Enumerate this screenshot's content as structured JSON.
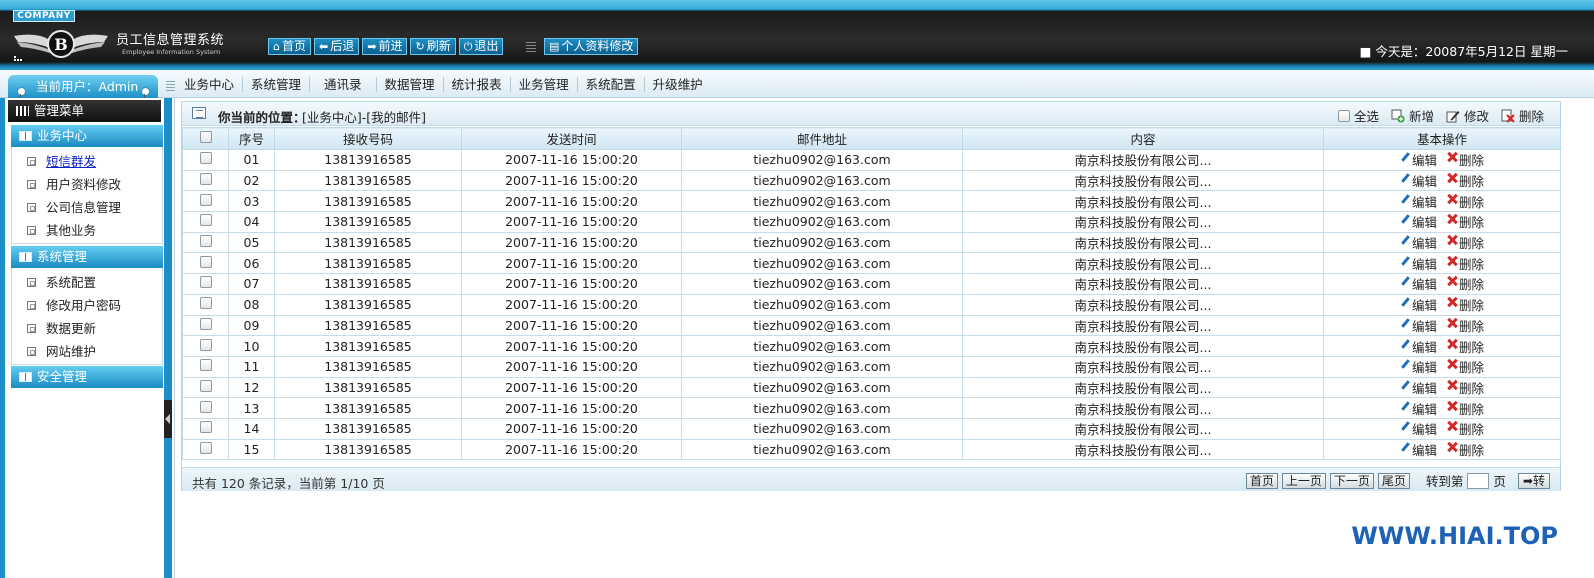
{
  "header": {
    "company_badge": "COMPANY",
    "title": "员工信息管理系统",
    "subtitle": "Employee Information System",
    "nav": [
      {
        "label": "首页",
        "icon": "home-icon"
      },
      {
        "label": "后退",
        "icon": "arrow-left-icon"
      },
      {
        "label": "前进",
        "icon": "arrow-right-icon"
      },
      {
        "label": "刷新",
        "icon": "refresh-icon"
      },
      {
        "label": "退出",
        "icon": "power-icon"
      }
    ],
    "profile_button": "个人资料修改",
    "date_text": "今天是：20087年5月12日 星期一"
  },
  "menubar": {
    "current_user": "当前用户：Admin",
    "items": [
      "业务中心",
      "系统管理",
      "通讯录",
      "数据管理",
      "统计报表",
      "业务管理",
      "系统配置",
      "升级维护"
    ]
  },
  "sidebar": {
    "title": "管理菜单",
    "sections": [
      {
        "title": "业务中心",
        "items": [
          "短信群发",
          "用户资料修改",
          "公司信息管理",
          "其他业务"
        ]
      },
      {
        "title": "系统管理",
        "items": [
          "系统配置",
          "修改用户密码",
          "数据更新",
          "网站维护"
        ]
      },
      {
        "title": "安全管理",
        "items": []
      }
    ]
  },
  "location": {
    "label": "你当前的位置：",
    "value": "[业务中心]-[我的邮件]"
  },
  "actions": {
    "select_all": "全选",
    "add": "新增",
    "edit": "修改",
    "delete": "删除"
  },
  "table": {
    "columns": [
      "序号",
      "接收号码",
      "发送时间",
      "邮件地址",
      "内容",
      "基本操作"
    ],
    "edit_label": "编辑",
    "delete_label": "删除",
    "rows": [
      [
        "01",
        "13813916585",
        "2007-11-16 15:00:20",
        "tiezhu0902@163.com",
        "南京科技股份有限公司..."
      ],
      [
        "02",
        "13813916585",
        "2007-11-16 15:00:20",
        "tiezhu0902@163.com",
        "南京科技股份有限公司..."
      ],
      [
        "03",
        "13813916585",
        "2007-11-16 15:00:20",
        "tiezhu0902@163.com",
        "南京科技股份有限公司..."
      ],
      [
        "04",
        "13813916585",
        "2007-11-16 15:00:20",
        "tiezhu0902@163.com",
        "南京科技股份有限公司..."
      ],
      [
        "05",
        "13813916585",
        "2007-11-16 15:00:20",
        "tiezhu0902@163.com",
        "南京科技股份有限公司..."
      ],
      [
        "06",
        "13813916585",
        "2007-11-16 15:00:20",
        "tiezhu0902@163.com",
        "南京科技股份有限公司..."
      ],
      [
        "07",
        "13813916585",
        "2007-11-16 15:00:20",
        "tiezhu0902@163.com",
        "南京科技股份有限公司..."
      ],
      [
        "08",
        "13813916585",
        "2007-11-16 15:00:20",
        "tiezhu0902@163.com",
        "南京科技股份有限公司..."
      ],
      [
        "09",
        "13813916585",
        "2007-11-16 15:00:20",
        "tiezhu0902@163.com",
        "南京科技股份有限公司..."
      ],
      [
        "10",
        "13813916585",
        "2007-11-16 15:00:20",
        "tiezhu0902@163.com",
        "南京科技股份有限公司..."
      ],
      [
        "11",
        "13813916585",
        "2007-11-16 15:00:20",
        "tiezhu0902@163.com",
        "南京科技股份有限公司..."
      ],
      [
        "12",
        "13813916585",
        "2007-11-16 15:00:20",
        "tiezhu0902@163.com",
        "南京科技股份有限公司..."
      ],
      [
        "13",
        "13813916585",
        "2007-11-16 15:00:20",
        "tiezhu0902@163.com",
        "南京科技股份有限公司..."
      ],
      [
        "14",
        "13813916585",
        "2007-11-16 15:00:20",
        "tiezhu0902@163.com",
        "南京科技股份有限公司..."
      ],
      [
        "15",
        "13813916585",
        "2007-11-16 15:00:20",
        "tiezhu0902@163.com",
        "南京科技股份有限公司..."
      ]
    ]
  },
  "footer": {
    "summary": "共有 120 条记录，当前第 1/10 页",
    "first": "首页",
    "prev": "上一页",
    "next": "下一页",
    "last": "尾页",
    "goto_label": "转到第",
    "page_unit": "页",
    "go": "转"
  },
  "watermark": "WWW.HIAI.TOP",
  "colors": {
    "accent": "#1c8fc8",
    "header_dark": "#1c1c1c",
    "link_active": "#0b23c9",
    "delete_red": "#d42828",
    "watermark": "#1d62b6"
  }
}
